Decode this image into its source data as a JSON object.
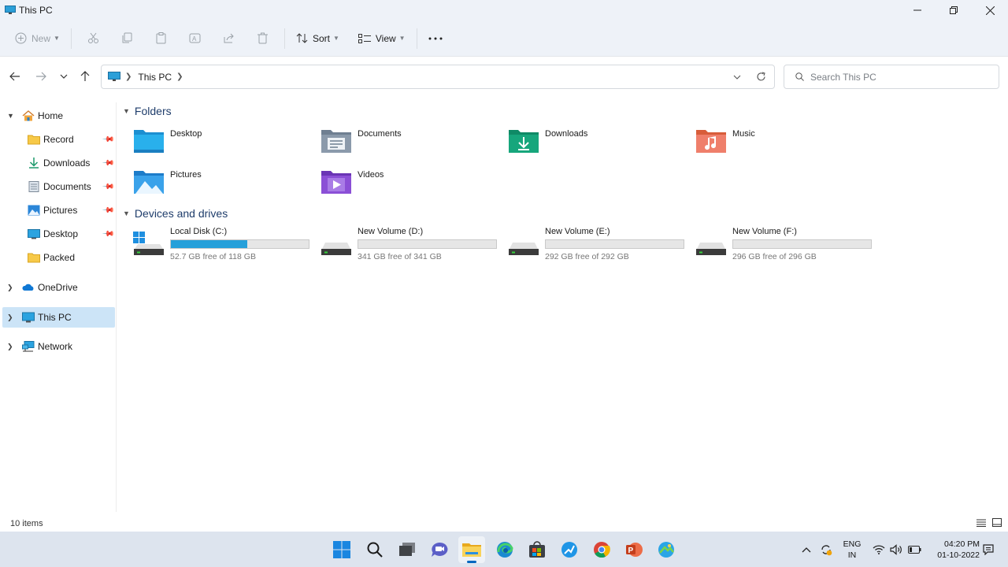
{
  "window": {
    "title": "This PC"
  },
  "toolbar": {
    "new_label": "New",
    "sort_label": "Sort",
    "view_label": "View",
    "icons": [
      "cut-icon",
      "copy-icon",
      "paste-icon",
      "rename-icon",
      "share-icon",
      "delete-icon",
      "more-icon"
    ]
  },
  "address": {
    "crumb": "This PC"
  },
  "search": {
    "placeholder": "Search This PC"
  },
  "sidebar": {
    "items": [
      {
        "label": "Home",
        "icon": "home-icon",
        "expanded": true
      },
      {
        "label": "Record",
        "icon": "folder-icon",
        "pinned": true
      },
      {
        "label": "Downloads",
        "icon": "download-icon",
        "pinned": true
      },
      {
        "label": "Documents",
        "icon": "documents-icon",
        "pinned": true
      },
      {
        "label": "Pictures",
        "icon": "pictures-icon",
        "pinned": true
      },
      {
        "label": "Desktop",
        "icon": "desktop-icon",
        "pinned": true
      },
      {
        "label": "Packed",
        "icon": "folder-icon"
      },
      {
        "label": "OneDrive",
        "icon": "cloud-icon"
      },
      {
        "label": "This PC",
        "icon": "computer-icon",
        "selected": true
      },
      {
        "label": "Network",
        "icon": "network-icon"
      }
    ]
  },
  "main": {
    "folders_heading": "Folders",
    "folders": [
      {
        "name": "Desktop",
        "icon": "desktop-folder-icon"
      },
      {
        "name": "Documents",
        "icon": "documents-folder-icon"
      },
      {
        "name": "Downloads",
        "icon": "downloads-folder-icon"
      },
      {
        "name": "Music",
        "icon": "music-folder-icon"
      },
      {
        "name": "Pictures",
        "icon": "pictures-folder-icon"
      },
      {
        "name": "Videos",
        "icon": "videos-folder-icon"
      }
    ],
    "drives_heading": "Devices and drives",
    "drives": [
      {
        "name": "Local Disk (C:)",
        "free_text": "52.7 GB free of 118 GB",
        "used_fraction": 0.553,
        "os_drive": true
      },
      {
        "name": "New Volume (D:)",
        "free_text": "341 GB free of 341 GB",
        "used_fraction": 0.0
      },
      {
        "name": "New Volume (E:)",
        "free_text": "292 GB free of 292 GB",
        "used_fraction": 0.0
      },
      {
        "name": "New Volume (F:)",
        "free_text": "296 GB free of 296 GB",
        "used_fraction": 0.0
      }
    ]
  },
  "status": {
    "item_count": "10 items"
  },
  "taskbar": {
    "apps": [
      "start-icon",
      "search-icon",
      "task-view-icon",
      "chat-icon",
      "file-explorer-icon",
      "edge-icon",
      "store-icon",
      "unknown-app-icon",
      "chrome-icon",
      "powerpoint-icon",
      "photos-icon"
    ],
    "active_app": "file-explorer-icon",
    "lang_line1": "ENG",
    "lang_line2": "IN",
    "time": "04:20 PM",
    "date": "01-10-2022"
  },
  "colors": {
    "accent": "#0067c0",
    "selected_bg": "#cce4f7",
    "drive_fill": "#26a0da",
    "heading": "#1f3d6b"
  }
}
